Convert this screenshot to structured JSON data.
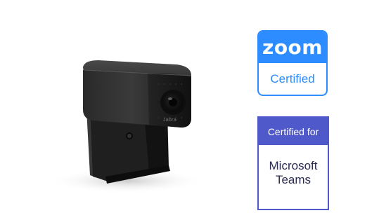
{
  "product": {
    "brand_label": "Jabra",
    "alt": "webcam"
  },
  "badges": {
    "zoom": {
      "logo_text": "zoom",
      "status": "Certified",
      "color": "#2d8cff"
    },
    "teams": {
      "header": "Certified for",
      "line1": "Microsoft",
      "line2": "Teams",
      "color": "#5059c9"
    }
  }
}
